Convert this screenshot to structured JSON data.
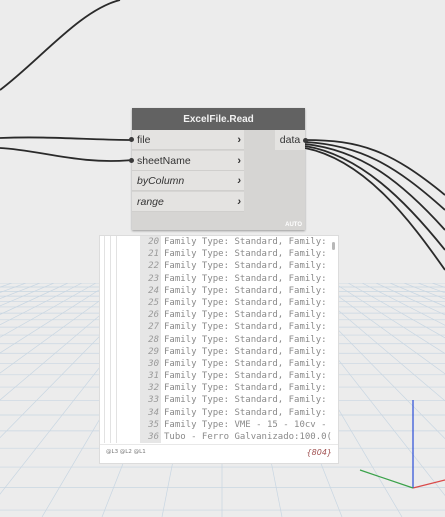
{
  "node": {
    "title": "ExcelFile.Read",
    "inputs": [
      {
        "label": "file",
        "italic": false
      },
      {
        "label": "sheetName",
        "italic": false
      },
      {
        "label": "byColumn",
        "italic": true
      },
      {
        "label": "range",
        "italic": true
      }
    ],
    "output": "data",
    "auto_badge": "AUTO",
    "chevron": "›"
  },
  "preview": {
    "rows": [
      {
        "index": "20",
        "text": "Family Type: Standard, Family:"
      },
      {
        "index": "21",
        "text": "Family Type: Standard, Family:"
      },
      {
        "index": "22",
        "text": "Family Type: Standard, Family:"
      },
      {
        "index": "23",
        "text": "Family Type: Standard, Family:"
      },
      {
        "index": "24",
        "text": "Family Type: Standard, Family:"
      },
      {
        "index": "25",
        "text": "Family Type: Standard, Family:"
      },
      {
        "index": "26",
        "text": "Family Type: Standard, Family:"
      },
      {
        "index": "27",
        "text": "Family Type: Standard, Family:"
      },
      {
        "index": "28",
        "text": "Family Type: Standard, Family:"
      },
      {
        "index": "29",
        "text": "Family Type: Standard, Family:"
      },
      {
        "index": "30",
        "text": "Family Type: Standard, Family:"
      },
      {
        "index": "31",
        "text": "Family Type: Standard, Family:"
      },
      {
        "index": "32",
        "text": "Family Type: Standard, Family:"
      },
      {
        "index": "33",
        "text": "Family Type: Standard, Family:"
      },
      {
        "index": "34",
        "text": "Family Type: Standard, Family:"
      },
      {
        "index": "35",
        "text": "Family Type: VME - 15 - 10cv -"
      },
      {
        "index": "36",
        "text": "Tubo - Ferro Galvanizado:100.0("
      }
    ],
    "levels": "@L3 @L2 @L1",
    "count": "{804}"
  },
  "colors": {
    "canvas": "#ececec",
    "node_header": "#626262",
    "node_body": "#d6d5d3",
    "grid": "#c9d7e3",
    "axis_red": "#d94a4a",
    "axis_blue": "#2a4ed8",
    "axis_green": "#3aa24a"
  }
}
